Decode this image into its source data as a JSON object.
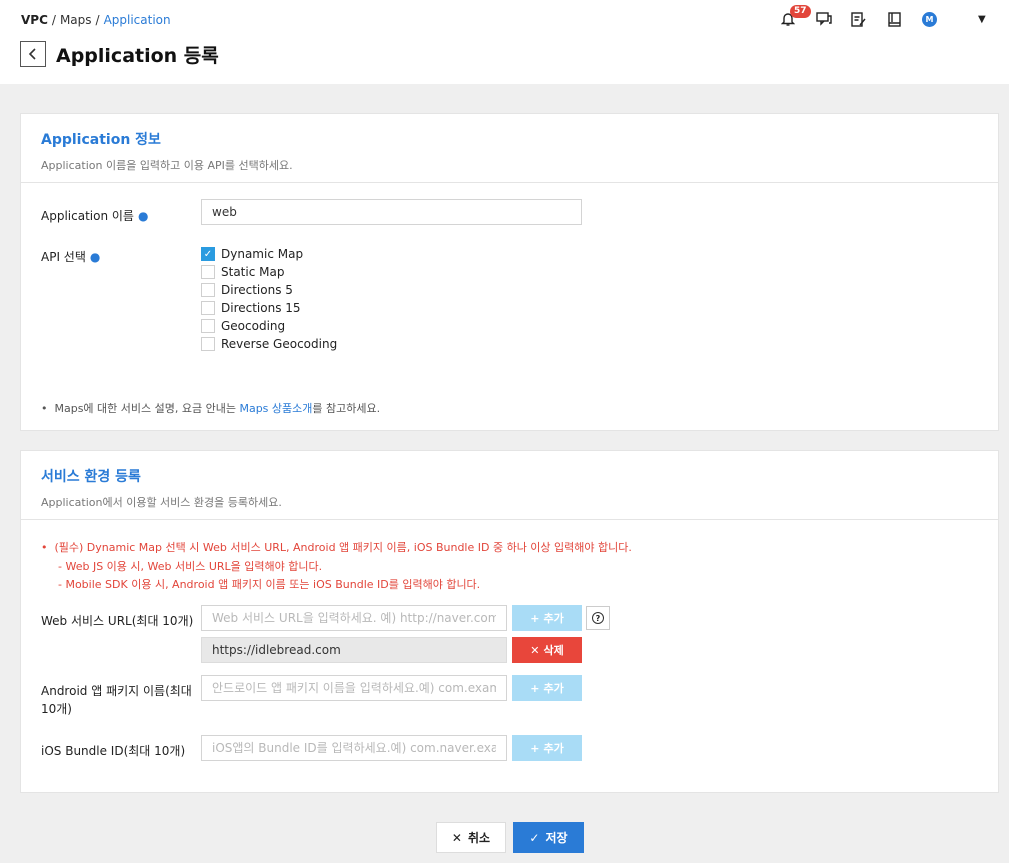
{
  "breadcrumb": {
    "root": "VPC",
    "sep": "/",
    "mid": "Maps",
    "current": "Application"
  },
  "page": {
    "title": "Application 등록"
  },
  "header": {
    "notification_count": "57",
    "avatar_letter": "M"
  },
  "app_info": {
    "title": "Application 정보",
    "desc": "Application 이름을 입력하고 이용 API를 선택하세요.",
    "name_label": "Application 이름",
    "name_value": "web",
    "api_label": "API 선택",
    "apis": [
      {
        "label": "Dynamic Map",
        "checked": true
      },
      {
        "label": "Static Map",
        "checked": false
      },
      {
        "label": "Directions 5",
        "checked": false
      },
      {
        "label": "Directions 15",
        "checked": false
      },
      {
        "label": "Geocoding",
        "checked": false
      },
      {
        "label": "Reverse Geocoding",
        "checked": false
      }
    ],
    "note_pre": "Maps에 대한 서비스 설명, 요금 안내는 ",
    "note_link": "Maps 상품소개",
    "note_post": "를 참고하세요."
  },
  "service_env": {
    "title": "서비스 환경 등록",
    "desc": "Application에서 이용할 서비스 환경을 등록하세요.",
    "warn1": "(필수) Dynamic Map 선택 시 Web 서비스 URL, Android 앱 패키지 이름, iOS Bundle ID 중 하나 이상 입력해야 합니다.",
    "warn2": "- Web JS 이용 시, Web 서비스 URL을 입력해야 합니다.",
    "warn3": "- Mobile SDK 이용 시, Android 앱 패키지 이름 또는 iOS Bundle ID를 입력해야 합니다.",
    "web_label": "Web 서비스 URL(최대 10개)",
    "web_placeholder": "Web 서비스 URL을 입력하세요. 예) http://naver.com",
    "web_url_value": "https://idlebread.com",
    "android_label_1": "Android 앱 패키지 이름(최대",
    "android_label_2": "10개)",
    "android_placeholder": "안드로이드 앱 패키지 이름을 입력하세요.예) com.example.",
    "ios_label": "iOS Bundle ID(최대 10개)",
    "ios_placeholder": "iOS앱의 Bundle ID를 입력하세요.예) com.naver.example.",
    "add_label": "추가",
    "delete_label": "삭제"
  },
  "footer": {
    "cancel_label": "취소",
    "save_label": "저장"
  }
}
